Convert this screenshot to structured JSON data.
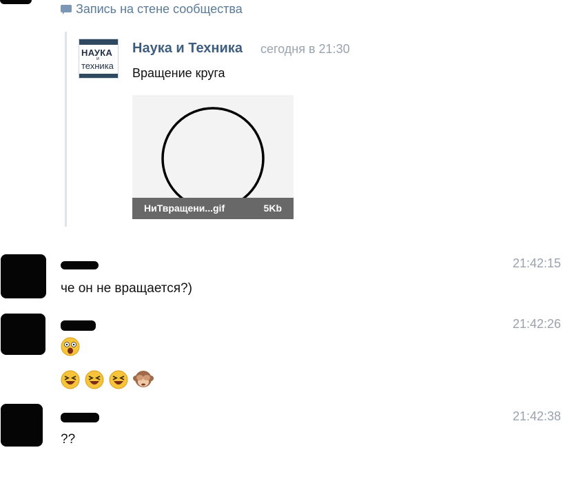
{
  "wall_post": {
    "label": "Запись на стене сообщества",
    "source": {
      "logo_line1": "НАУКА",
      "logo_line2": "и",
      "logo_line3": "техника",
      "name": "Наука и Техника",
      "time": "сегодня в 21:30"
    },
    "text": "Вращение круга",
    "attachment": {
      "filename": "НиТвращени...gif",
      "size": "5Kb"
    }
  },
  "messages": [
    {
      "time": "21:42:15",
      "text": "че он не вращается?)"
    },
    {
      "time": "21:42:26",
      "emoji_first": [
        "shocked-face-emoji"
      ],
      "emoji_second": [
        "laughing-face-emoji",
        "laughing-face-emoji",
        "laughing-face-emoji",
        "see-no-evil-monkey-emoji"
      ]
    },
    {
      "time": "21:42:38",
      "text": "??"
    }
  ],
  "colors": {
    "link": "#3f5e7f",
    "muted": "#9aa3ad",
    "quote_line": "#dde3ea",
    "gif_bar": "#686868"
  }
}
